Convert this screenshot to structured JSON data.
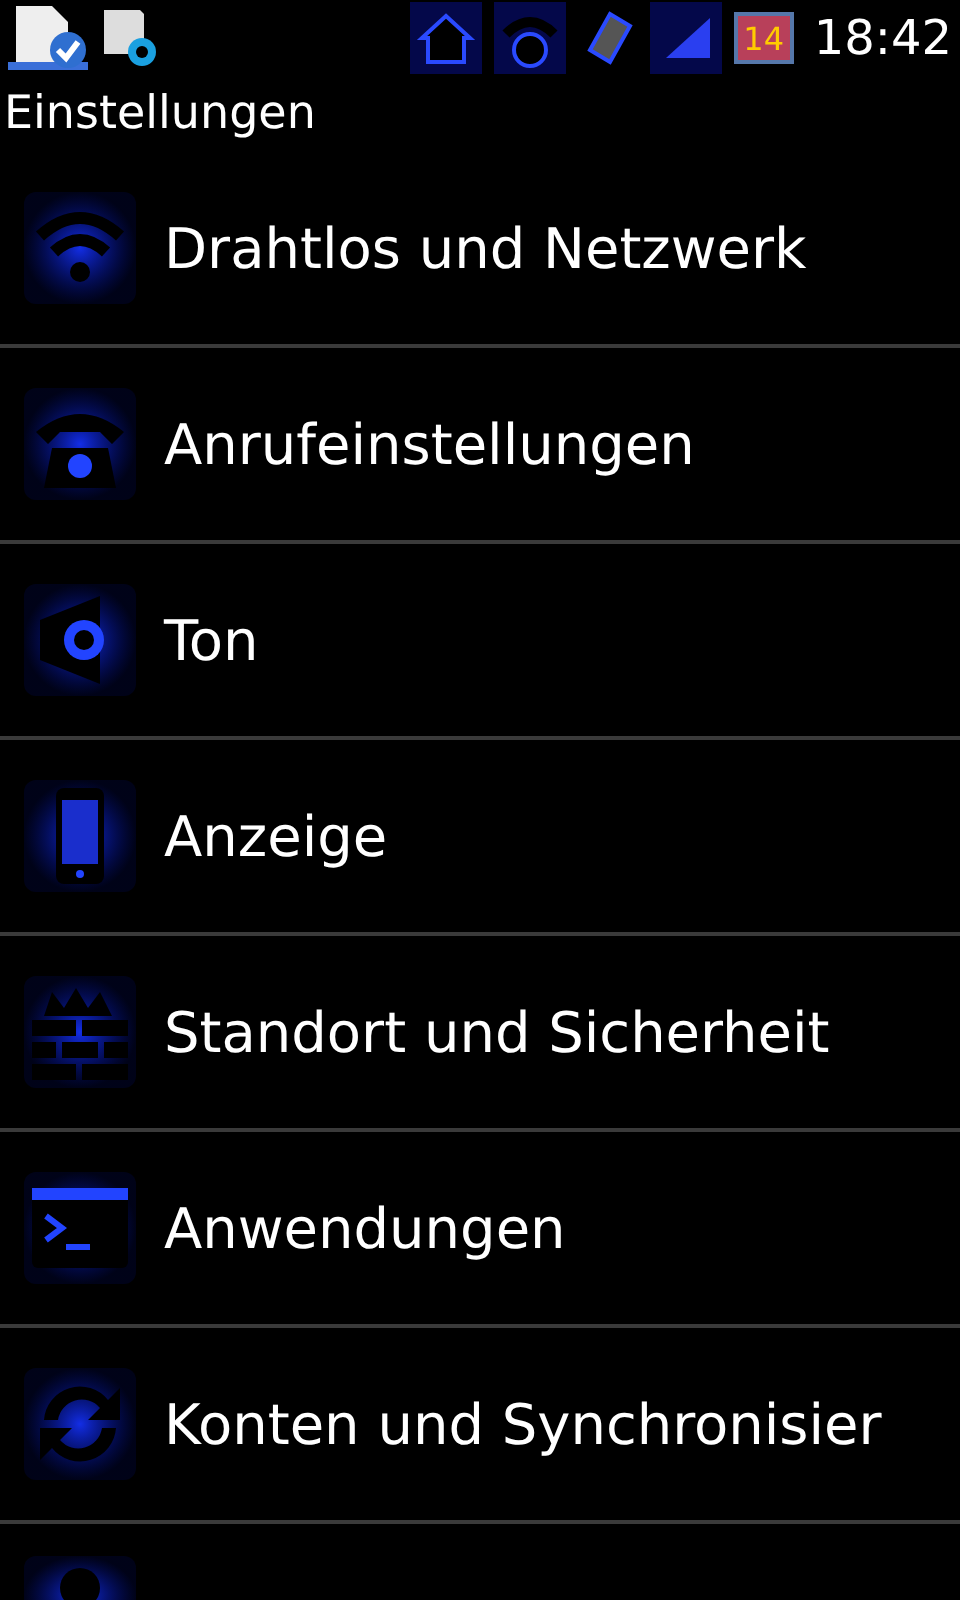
{
  "status_bar": {
    "calendar_day": "14",
    "time": "18:42"
  },
  "title": "Einstellungen",
  "items": [
    {
      "label": "Drahtlos und Netzwerk"
    },
    {
      "label": "Anrufeinstellungen"
    },
    {
      "label": "Ton"
    },
    {
      "label": "Anzeige"
    },
    {
      "label": "Standort und Sicherheit"
    },
    {
      "label": "Anwendungen"
    },
    {
      "label": "Konten und Synchronisier"
    }
  ]
}
